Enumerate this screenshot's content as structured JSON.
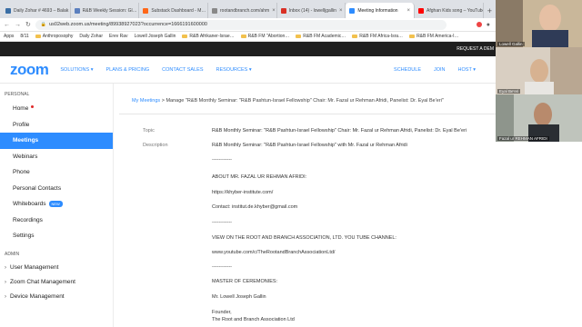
{
  "browser": {
    "tabs": [
      {
        "label": "Daily Zohar # 4693 – Balak",
        "favicon_color": "#3a6ea5",
        "active": false
      },
      {
        "label": "R&B Weekly Session: Gl…",
        "favicon_color": "#5b7fbe",
        "active": false
      },
      {
        "label": "Substack Dashboard - M…",
        "favicon_color": "#ff6719",
        "active": false
      },
      {
        "label": "rootandbranch.com/ahm",
        "favicon_color": "#888888",
        "active": false
      },
      {
        "label": "Inbox (14) - lowelljgallin",
        "favicon_color": "#d93025",
        "active": false
      },
      {
        "label": "Meeting Information",
        "favicon_color": "#2d8cff",
        "active": true
      },
      {
        "label": "Afghan Kids song – YouTube",
        "favicon_color": "#ff0000",
        "active": false
      }
    ],
    "new_tab": "+",
    "url": "us02web.zoom.us/meeting/89938927023?occurrence=1666191600000",
    "bookmarks": [
      {
        "label": "Apps",
        "folder": false
      },
      {
        "label": "8/11",
        "folder": false
      },
      {
        "label": "Anthroposophy",
        "folder": true
      },
      {
        "label": "Daily Zohar",
        "folder": false
      },
      {
        "label": "Erev Rav",
        "folder": false
      },
      {
        "label": "Lowell Joseph Gallin",
        "folder": false
      },
      {
        "label": "R&B Afrikaner-Israe…",
        "folder": true
      },
      {
        "label": "R&B FM \"Abortion…",
        "folder": true
      },
      {
        "label": "R&B FM Academic…",
        "folder": true
      },
      {
        "label": "R&B FM Africa-Isra…",
        "folder": true
      },
      {
        "label": "R&B FM America-I…",
        "folder": true
      }
    ]
  },
  "zoom_header": {
    "request_demo": "REQUEST A DEM",
    "logo": "zoom",
    "nav": [
      "SOLUTIONS ▾",
      "PLANS & PRICING",
      "CONTACT SALES",
      "RESOURCES ▾"
    ],
    "right": [
      "SCHEDULE",
      "JOIN",
      "HOST ▾"
    ]
  },
  "sidebar": {
    "personal_title": "PERSONAL",
    "items": [
      {
        "label": "Home",
        "dot": true
      },
      {
        "label": "Profile"
      },
      {
        "label": "Meetings",
        "active": true
      },
      {
        "label": "Webinars"
      },
      {
        "label": "Phone"
      },
      {
        "label": "Personal Contacts"
      },
      {
        "label": "Whiteboards",
        "badge": "NEW"
      },
      {
        "label": "Recordings"
      },
      {
        "label": "Settings"
      }
    ],
    "admin_title": "ADMIN",
    "admin_items": [
      "User Management",
      "Zoom Chat Management",
      "Device Management"
    ]
  },
  "main": {
    "breadcrumb_link": "My Meetings",
    "breadcrumb_sep": ">",
    "breadcrumb_current": "Manage \"R&B Monthly Seminar: \"R&B Pashtun-Israel Fellowship\" Chair: Mr. Fazal ur Rehman Afridi, Panelist: Dr. Eyal Be'eri\"",
    "topic_label": "Topic",
    "topic_value": "R&B Monthly Seminar: \"R&B Pashtun-Israel Fellowship\" Chair: Mr. Fazal ur Rehman Afridi, Panelist: Dr. Eyal Be'eri",
    "description_label": "Description",
    "description_lines": [
      "R&B Monthly Seminar: \"R&B Pashtun-Israel Fellowship\" with Mr. Fazal ur Rehman Afridi",
      "------------",
      "ABOUT MR. FAZAL UR REHMAN AFRIDI:",
      "https://khyber-institute.com/",
      "Contact: institut.de.khyber@gmail.com",
      "------------",
      "VIEW ON THE ROOT AND BRANCH ASSOCIATION, LTD. YOU TUBE CHANNEL:",
      "www.youtube.com/c/TheRootandBranchAssociationLtd/",
      "------------",
      "MASTER OF CEREMONIES:",
      "Mr. Lowell Joseph Gallin",
      "Founder,",
      "The Root and Branch Association Ltd"
    ]
  },
  "video": {
    "window_controls": [
      "—",
      "☐",
      "✕"
    ],
    "participants": [
      {
        "name": "Lowell Gallin"
      },
      {
        "name": "Eyal Be'eri"
      },
      {
        "name": "Fazal ur REHMAN AFRIDI"
      }
    ]
  }
}
